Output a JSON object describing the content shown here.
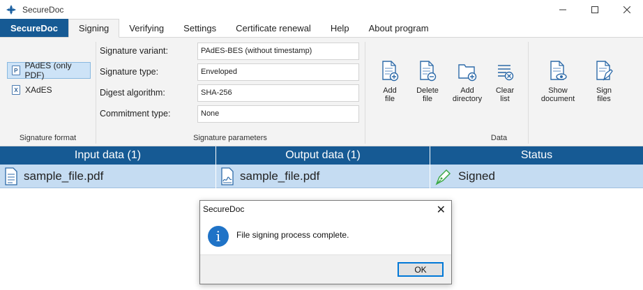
{
  "window": {
    "title": "SecureDoc",
    "controls": {
      "minimize": "—",
      "maximize": "☐",
      "close": "✕"
    }
  },
  "tabs": [
    {
      "label": "SecureDoc"
    },
    {
      "label": "Signing"
    },
    {
      "label": "Verifying"
    },
    {
      "label": "Settings"
    },
    {
      "label": "Certificate renewal"
    },
    {
      "label": "Help"
    },
    {
      "label": "About program"
    }
  ],
  "signature_format": {
    "label": "Signature format",
    "items": [
      {
        "label": "PAdES (only PDF)",
        "icon": "P"
      },
      {
        "label": "XAdES",
        "icon": "X"
      }
    ]
  },
  "signature_parameters": {
    "label": "Signature parameters",
    "rows": [
      {
        "label": "Signature variant:",
        "value": "PAdES-BES (without timestamp)"
      },
      {
        "label": "Signature type:",
        "value": "Enveloped"
      },
      {
        "label": "Digest algorithm:",
        "value": "SHA-256"
      },
      {
        "label": "Commitment type:",
        "value": "None"
      }
    ]
  },
  "data_group": {
    "label": "Data",
    "buttons": [
      {
        "line1": "Add",
        "line2": "file",
        "icon": "add-file-icon"
      },
      {
        "line1": "Delete",
        "line2": "file",
        "icon": "delete-file-icon"
      },
      {
        "line1": "Add",
        "line2": "directory",
        "icon": "add-folder-icon"
      },
      {
        "line1": "Clear",
        "line2": "list",
        "icon": "clear-list-icon"
      },
      {
        "line1": "Show",
        "line2": "document",
        "icon": "show-document-icon"
      },
      {
        "line1": "Sign",
        "line2": "files",
        "icon": "sign-files-icon"
      }
    ]
  },
  "table": {
    "headers": [
      "Input data (1)",
      "Output data (1)",
      "Status"
    ],
    "rows": [
      {
        "input": "sample_file.pdf",
        "output": "sample_file.pdf",
        "status": "Signed"
      }
    ]
  },
  "dialog": {
    "title": "SecureDoc",
    "message": "File signing process complete.",
    "ok_label": "OK",
    "close": "✕",
    "icon_glyph": "i"
  },
  "colors": {
    "brand": "#165a94",
    "row_selected": "#c5dcf2",
    "dialog_icon": "#1f73c7",
    "signed_icon": "#3aa845"
  }
}
